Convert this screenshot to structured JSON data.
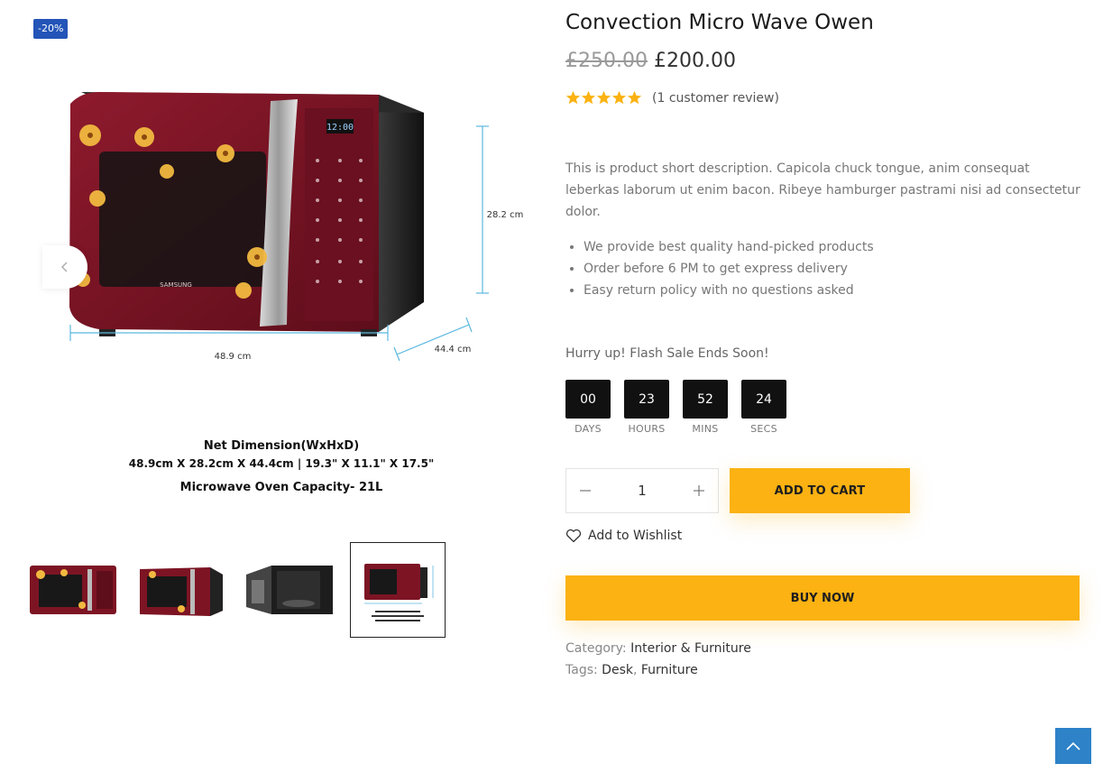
{
  "badge": {
    "discount": "-20%"
  },
  "gallery": {
    "image_text": {
      "height_dim": "28.2 cm",
      "width_dim": "48.9 cm",
      "depth_dim": "44.4 cm",
      "net_dimension": "Net Dimension(WxHxD)",
      "dims_line": "48.9cm X 28.2cm X 44.4cm  |  19.3\" X 11.1\" X 17.5\"",
      "capacity": "Microwave Oven Capacity- 21L",
      "brand": "SAMSUNG",
      "display": "12:00"
    },
    "thumbnail_count": 4,
    "active_thumbnail": 4
  },
  "product": {
    "title": "Convection Micro Wave Owen",
    "price_old": "£250.00",
    "price_new": "£200.00",
    "rating": 5,
    "review_text": "(1 customer review)",
    "short_description": "This is product short description. Capicola chuck tongue, anim consequat leberkas laborum ut enim bacon. Ribeye hamburger pastrami nisi ad consectetur dolor.",
    "features": [
      "We provide best quality hand-picked products",
      "Order before 6 PM to get express delivery",
      "Easy return policy with no questions asked"
    ]
  },
  "flash_sale": {
    "label": "Hurry up! Flash Sale Ends Soon!",
    "units": [
      {
        "value": "00",
        "label": "DAYS"
      },
      {
        "value": "23",
        "label": "HOURS"
      },
      {
        "value": "52",
        "label": "MINS"
      },
      {
        "value": "24",
        "label": "SECS"
      }
    ]
  },
  "cart": {
    "quantity": "1",
    "add_to_cart": "ADD TO CART",
    "wishlist": "Add to Wishlist",
    "buy_now": "BUY NOW"
  },
  "meta": {
    "category_label": "Category:",
    "category": "Interior & Furniture",
    "tags_label": "Tags:",
    "tags": [
      "Desk",
      "Furniture"
    ],
    "tag_separator": ","
  },
  "colors": {
    "accent": "#fbb212",
    "badge": "#2354b8",
    "scroll_top": "#2d82c8",
    "oven_red": "#7d1424"
  }
}
